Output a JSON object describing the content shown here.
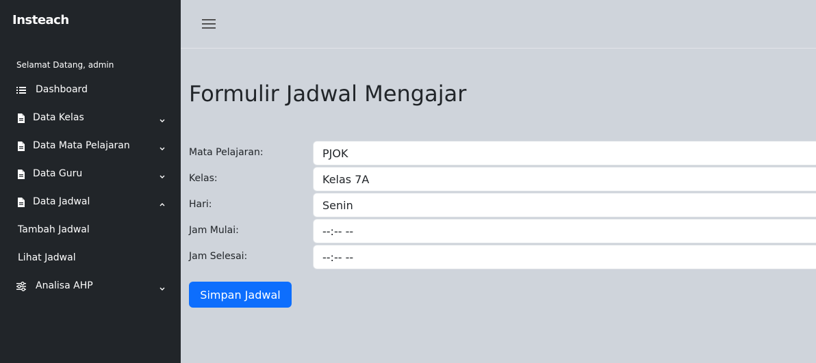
{
  "app": {
    "brand": "Insteach"
  },
  "sidebar": {
    "welcome": "Selamat Datang, admin",
    "items": [
      {
        "label": "Dashboard",
        "icon": "list-icon"
      },
      {
        "label": "Data Kelas",
        "icon": "file-icon",
        "expanded": false
      },
      {
        "label": "Data Mata Pelajaran",
        "icon": "file-icon",
        "expanded": false
      },
      {
        "label": "Data Guru",
        "icon": "file-icon",
        "expanded": false
      },
      {
        "label": "Data Jadwal",
        "icon": "file-icon",
        "expanded": true
      },
      {
        "label": "Analisa AHP",
        "icon": "sliders-icon",
        "expanded": false
      }
    ],
    "sub_items": [
      {
        "label": "Tambah Jadwal"
      },
      {
        "label": "Lihat Jadwal"
      }
    ]
  },
  "main": {
    "title": "Formulir Jadwal Mengajar",
    "form": {
      "fields": [
        {
          "label": "Mata Pelajaran:",
          "value": "PJOK"
        },
        {
          "label": "Kelas:",
          "value": "Kelas 7A"
        },
        {
          "label": "Hari:",
          "value": "Senin"
        },
        {
          "label": "Jam Mulai:",
          "value": "--:-- --"
        },
        {
          "label": "Jam Selesai:",
          "value": "--:-- --"
        }
      ],
      "submit_label": "Simpan Jadwal"
    }
  },
  "colors": {
    "sidebar_bg": "#212529",
    "content_bg": "#cfd4db",
    "primary": "#0d6efd"
  }
}
